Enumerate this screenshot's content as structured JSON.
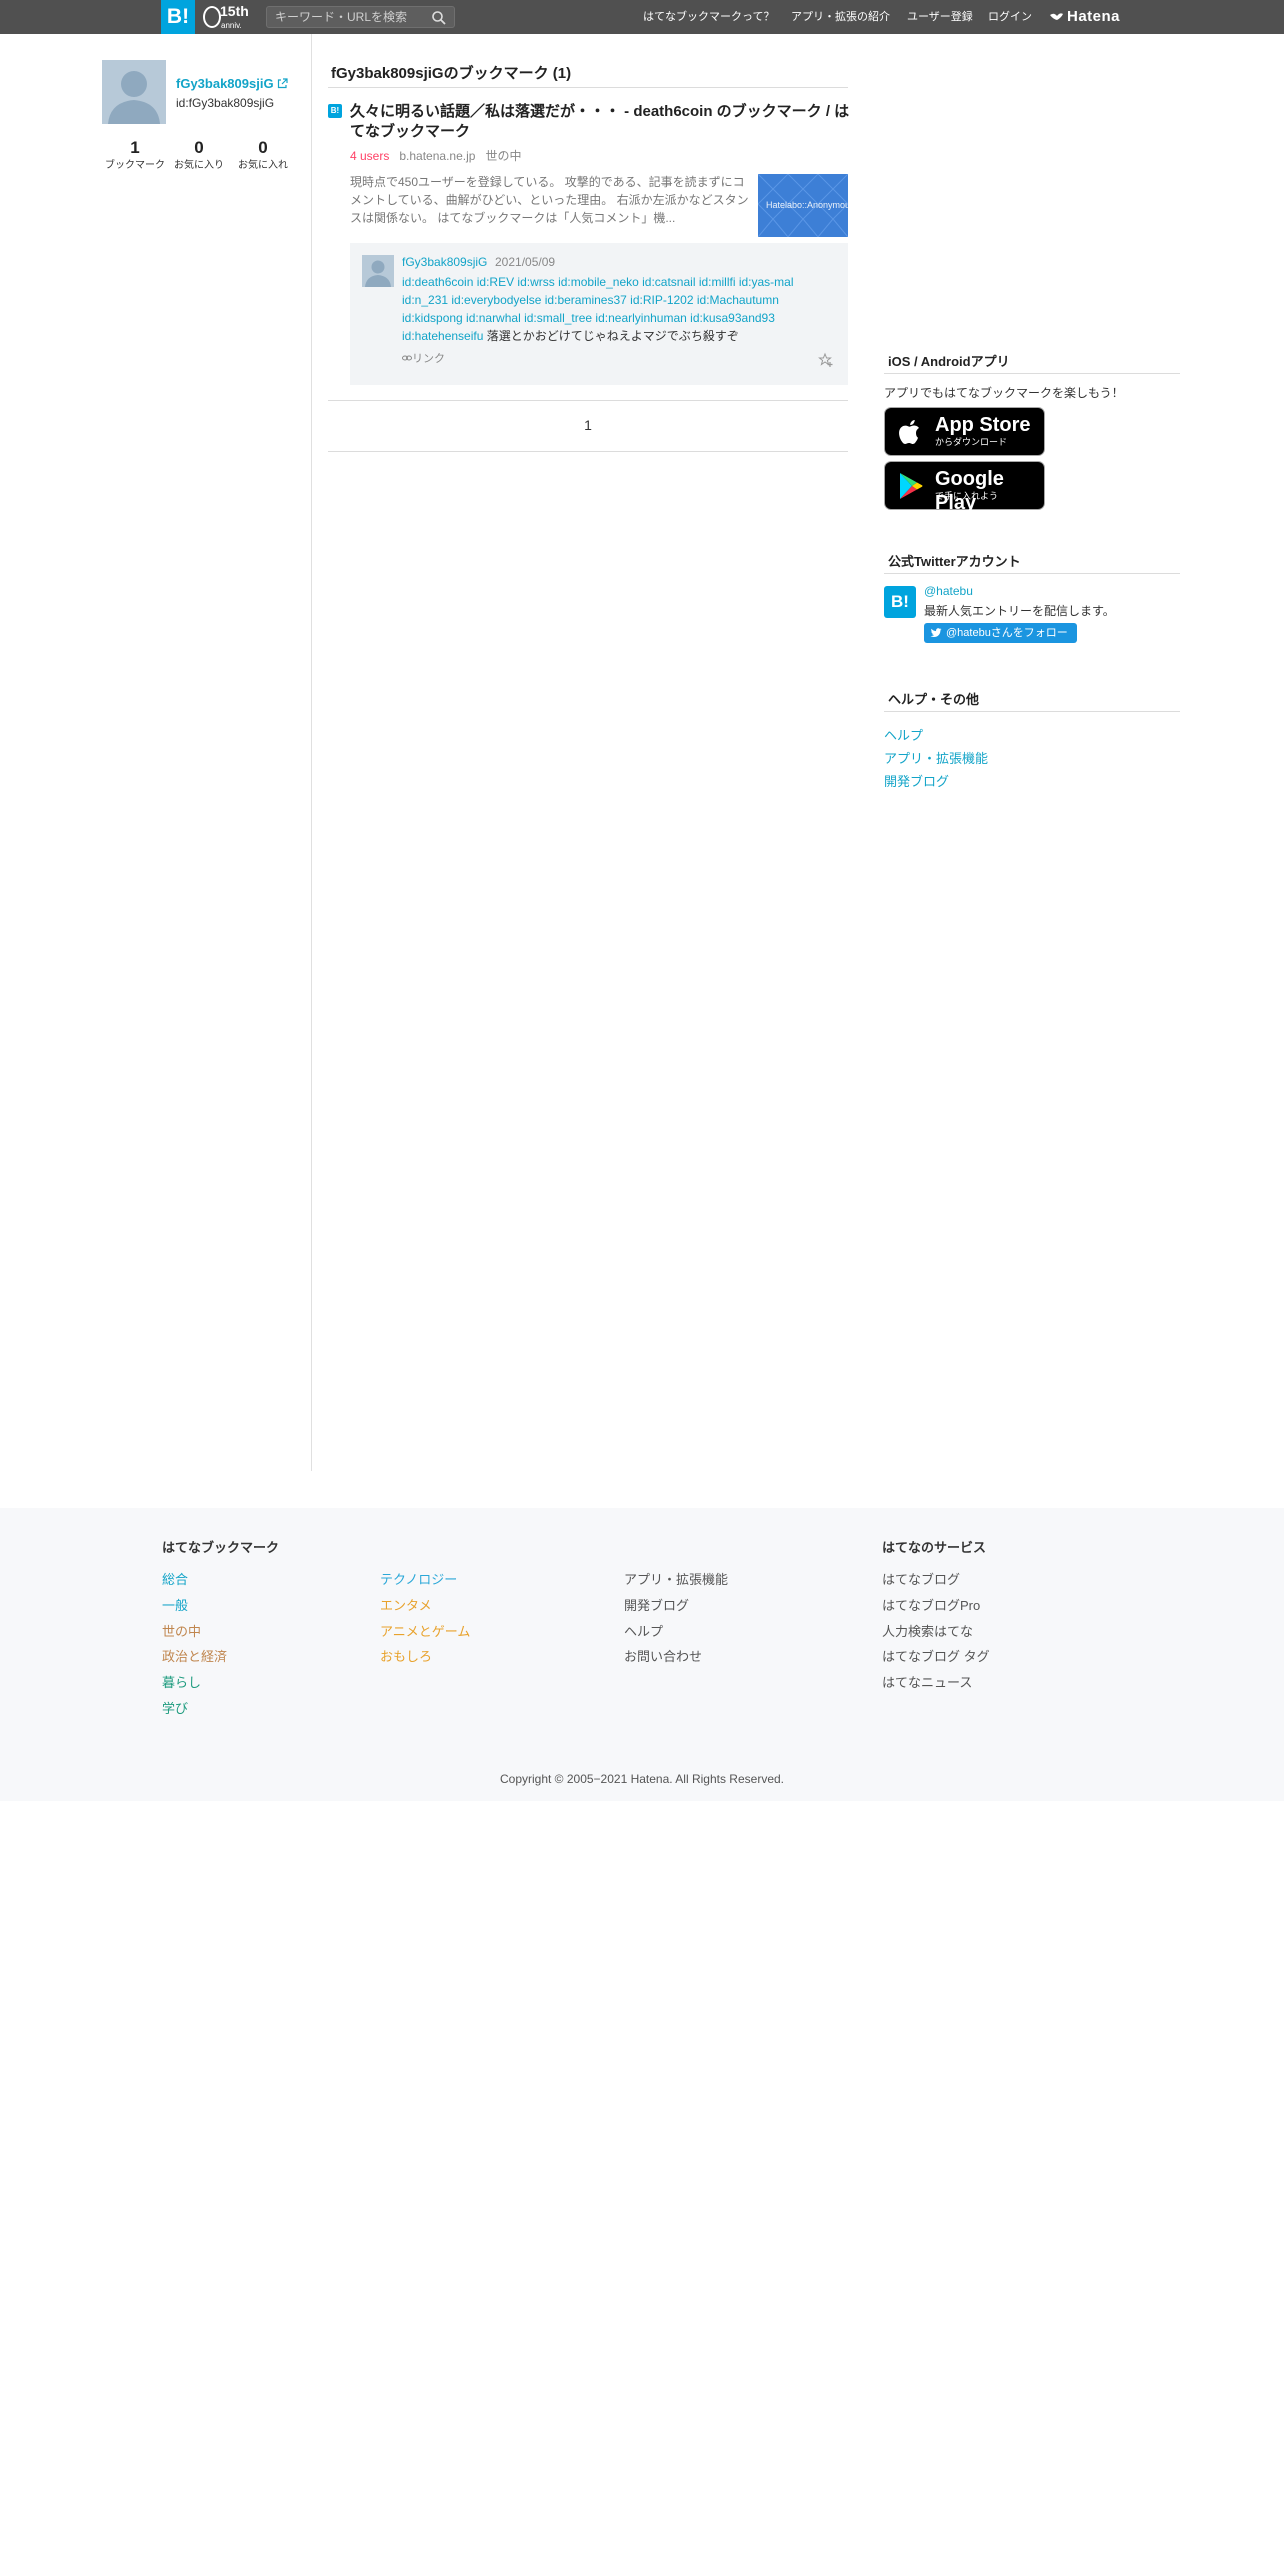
{
  "header": {
    "logo": "B!",
    "anniversary": {
      "num": "15th",
      "sub": "anniv."
    },
    "search_placeholder": "キーワード・URLを検索",
    "nav": [
      "はてなブックマークって？",
      "アプリ・拡張の紹介",
      "ユーザー登録",
      "ログイン"
    ],
    "hatena_logo": "Hatena"
  },
  "profile": {
    "name": "fGy3bak809sjiG",
    "id": "id:fGy3bak809sjiG",
    "stats": [
      {
        "num": "1",
        "label": "ブックマーク"
      },
      {
        "num": "0",
        "label": "お気に入り"
      },
      {
        "num": "0",
        "label": "お気に入れ"
      }
    ]
  },
  "main": {
    "title": "fGy3bak809sjiGのブックマーク (1)",
    "entry": {
      "title": "久々に明るい話題／私は落選だが・・・ - death6coin のブックマーク / はてなブックマーク",
      "users": "4 users",
      "host": "b.hatena.ne.jp",
      "category": "世の中",
      "description": "現時点で450ユーザーを登録している。 攻撃的である、記事を読まずにコメントしている、曲解がひどい、といった理由。 右派か左派かなどスタンスは関係ない。 はてなブックマークは「人気コメント」機...",
      "thumb_text": "Hatelabo::AnonymousDiary"
    },
    "comment": {
      "user": "fGy3bak809sjiG",
      "date": "2021/05/09",
      "ids": "id:death6coin id:REV id:wrss id:mobile_neko id:catsnail id:millfi id:yas-mal id:n_231 id:everybodyelse id:beramines37 id:RIP-1202 id:Machautumn id:kidspong id:narwhal id:small_tree id:nearlyinhuman id:kusa93and93 id:hatehenseifu",
      "text": "落選とかおどけてじゃねえよマジでぶち殺すぞ",
      "link_label": "リンク"
    },
    "pager": "1"
  },
  "sidebar": {
    "apps": {
      "title": "iOS / Androidアプリ",
      "text": "アプリでもはてなブックマークを楽しもう！",
      "appstore": {
        "big": "App Store",
        "small": "からダウンロード"
      },
      "googleplay": {
        "big": "Google Play",
        "small": "で手に入れよう"
      }
    },
    "twitter": {
      "title": "公式Twitterアカウント",
      "handle": "@hatebu",
      "desc": "最新人気エントリーを配信します。",
      "follow": "@hatebuさんをフォロー"
    },
    "help": {
      "title": "ヘルプ・その他",
      "links": [
        "ヘルプ",
        "アプリ・拡張機能",
        "開発ブログ"
      ]
    }
  },
  "footer": {
    "bookmark_title": "はてなブックマーク",
    "col1": [
      "総合",
      "一般",
      "世の中",
      "政治と経済",
      "暮らし",
      "学び"
    ],
    "col2": [
      "テクノロジー",
      "エンタメ",
      "アニメとゲーム",
      "おもしろ"
    ],
    "col3": [
      "アプリ・拡張機能",
      "開発ブログ",
      "ヘルプ",
      "お問い合わせ"
    ],
    "services_title": "はてなのサービス",
    "col4": [
      "はてなブログ",
      "はてなブログPro",
      "人力検索はてな",
      "はてなブログ タグ",
      "はてなニュース"
    ],
    "copyright": "Copyright © 2005−2021 Hatena. All Rights Reserved.",
    "category_colors": {
      "総合": "#13a4c8",
      "一般": "#13a4c8",
      "世の中": "#c0864e",
      "政治と経済": "#c0864e",
      "暮らし": "#1d9b7e",
      "学び": "#1d9b7e",
      "テクノロジー": "#2ba8d8",
      "エンタメ": "#e8a22c",
      "アニメとゲーム": "#e8a22c",
      "おもしろ": "#e8a22c"
    }
  }
}
